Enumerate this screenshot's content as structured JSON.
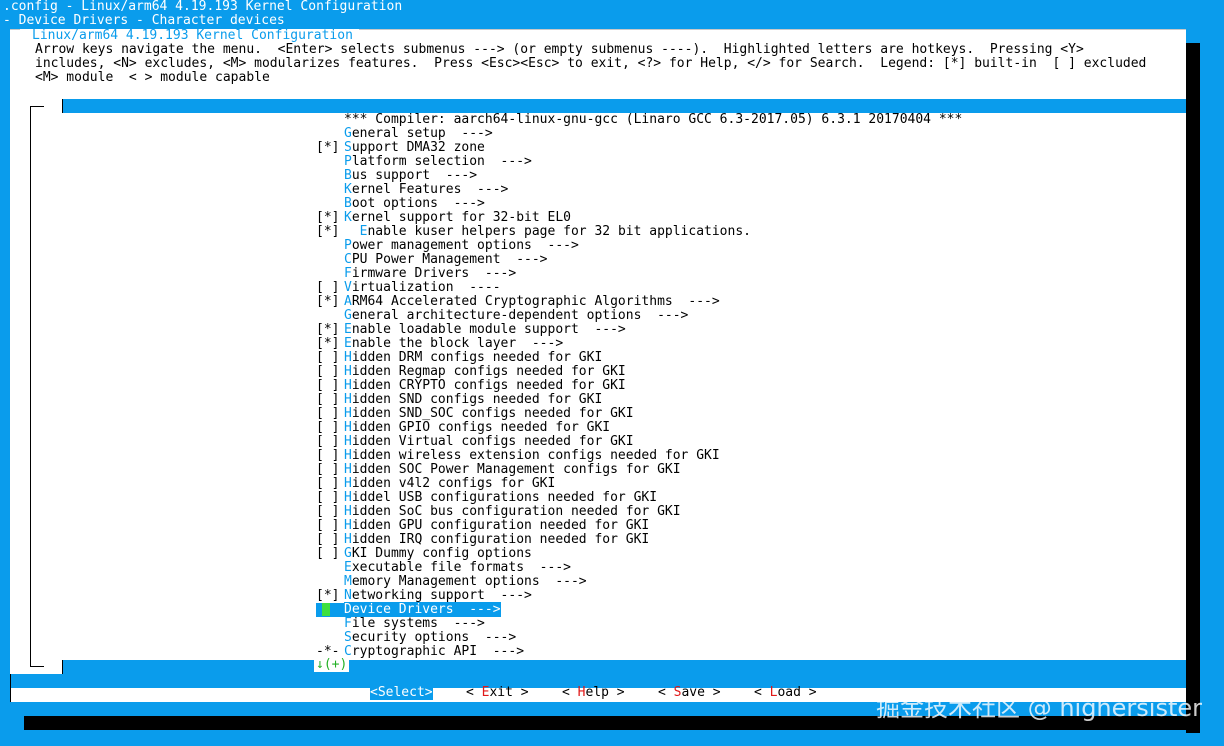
{
  "header": {
    "line1": ".config - Linux/arm64 4.19.193 Kernel Configuration",
    "line2": "- Device Drivers - Character devices"
  },
  "dialog": {
    "title": "Linux/arm64 4.19.193 Kernel Configuration",
    "instructions": [
      "Arrow keys navigate the menu.  <Enter> selects submenus ---> (or empty submenus ----).  Highlighted letters are hotkeys.  Pressing <Y>",
      "includes, <N> excludes, <M> modularizes features.  Press <Esc><Esc> to exit, <?> for Help, </> for Search.  Legend: [*] built-in  [ ] excluded",
      "<M> module  < > module capable"
    ]
  },
  "menu": {
    "items": [
      {
        "mark": "",
        "hot": "",
        "text": "*** Compiler: aarch64-linux-gnu-gcc (Linaro GCC 6.3-2017.05) 6.3.1 20170404 ***"
      },
      {
        "mark": "",
        "hot": "G",
        "text": "eneral setup  --->"
      },
      {
        "mark": "[*]",
        "hot": "S",
        "text": "upport DMA32 zone"
      },
      {
        "mark": "",
        "hot": "P",
        "text": "latform selection  --->"
      },
      {
        "mark": "",
        "hot": "B",
        "text": "us support  --->"
      },
      {
        "mark": "",
        "hot": "K",
        "text": "ernel Features  --->"
      },
      {
        "mark": "",
        "hot": "B",
        "text": "oot options  --->"
      },
      {
        "mark": "[*]",
        "hot": "K",
        "text": "ernel support for 32-bit EL0"
      },
      {
        "mark": "[*]",
        "hot": "  E",
        "text": "nable kuser helpers page for 32 bit applications."
      },
      {
        "mark": "",
        "hot": "P",
        "text": "ower management options  --->"
      },
      {
        "mark": "",
        "hot": "C",
        "text": "PU Power Management  --->"
      },
      {
        "mark": "",
        "hot": "F",
        "text": "irmware Drivers  --->"
      },
      {
        "mark": "[ ]",
        "hot": "V",
        "text": "irtualization  ----"
      },
      {
        "mark": "[*]",
        "hot": "A",
        "text": "RM64 Accelerated Cryptographic Algorithms  --->"
      },
      {
        "mark": "",
        "hot": "G",
        "text": "eneral architecture-dependent options  --->"
      },
      {
        "mark": "[*]",
        "hot": "E",
        "text": "nable loadable module support  --->"
      },
      {
        "mark": "[*]",
        "hot": "E",
        "text": "nable the block layer  --->"
      },
      {
        "mark": "[ ]",
        "hot": "H",
        "text": "idden DRM configs needed for GKI"
      },
      {
        "mark": "[ ]",
        "hot": "H",
        "text": "idden Regmap configs needed for GKI"
      },
      {
        "mark": "[ ]",
        "hot": "H",
        "text": "idden CRYPTO configs needed for GKI"
      },
      {
        "mark": "[ ]",
        "hot": "H",
        "text": "idden SND configs needed for GKI"
      },
      {
        "mark": "[ ]",
        "hot": "H",
        "text": "idden SND_SOC configs needed for GKI"
      },
      {
        "mark": "[ ]",
        "hot": "H",
        "text": "idden GPIO configs needed for GKI"
      },
      {
        "mark": "[ ]",
        "hot": "H",
        "text": "idden Virtual configs needed for GKI"
      },
      {
        "mark": "[ ]",
        "hot": "H",
        "text": "idden wireless extension configs needed for GKI"
      },
      {
        "mark": "[ ]",
        "hot": "H",
        "text": "idden SOC Power Management configs for GKI"
      },
      {
        "mark": "[ ]",
        "hot": "H",
        "text": "idden v4l2 configs for GKI"
      },
      {
        "mark": "[ ]",
        "hot": "H",
        "text": "iddel USB configurations needed for GKI"
      },
      {
        "mark": "[ ]",
        "hot": "H",
        "text": "idden SoC bus configuration needed for GKI"
      },
      {
        "mark": "[ ]",
        "hot": "H",
        "text": "idden GPU configuration needed for GKI"
      },
      {
        "mark": "[ ]",
        "hot": "H",
        "text": "idden IRQ configuration needed for GKI"
      },
      {
        "mark": "[ ]",
        "hot": "G",
        "text": "KI Dummy config options"
      },
      {
        "mark": "",
        "hot": "E",
        "text": "xecutable file formats  --->"
      },
      {
        "mark": "",
        "hot": "M",
        "text": "emory Management options  --->"
      },
      {
        "mark": "[*]",
        "hot": "N",
        "text": "etworking support  --->"
      },
      {
        "mark": "",
        "hot": "D",
        "text": "evice Drivers  --->",
        "selected": true
      },
      {
        "mark": "",
        "hot": "F",
        "text": "ile systems  --->"
      },
      {
        "mark": "",
        "hot": "S",
        "text": "ecurity options  --->"
      },
      {
        "mark": "-*-",
        "hot": "C",
        "text": "ryptographic API  --->"
      }
    ],
    "more_indicator": "↓(+)"
  },
  "buttons": {
    "select": {
      "pre": "<",
      "hot": "S",
      "post": "elect>"
    },
    "exit": {
      "pre": "< ",
      "hot": "E",
      "post": "xit >"
    },
    "help": {
      "pre": "< ",
      "hot": "H",
      "post": "elp >"
    },
    "save": {
      "pre": "< ",
      "hot": "S",
      "post": "ave >"
    },
    "load": {
      "pre": "< ",
      "hot": "L",
      "post": "oad >"
    }
  },
  "watermark": "掘金技术社区 @ highersister",
  "colors": {
    "background": "#0a9cec",
    "dialog": "#ffffff",
    "hotkey": "#0a9cec",
    "button_hotkey": "#e01818",
    "more_indicator": "#23b025"
  }
}
